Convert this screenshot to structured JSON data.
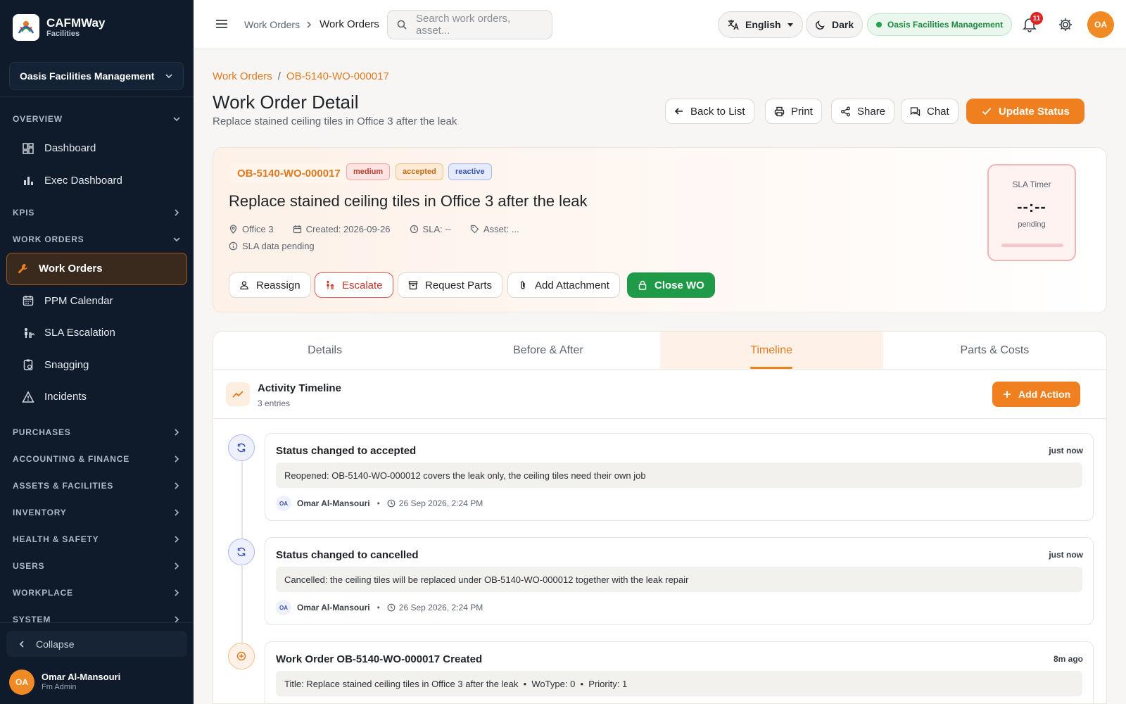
{
  "app": {
    "name": "CAFMWay",
    "subtitle": "Facilities"
  },
  "sidebar": {
    "org": "Oasis Facilities Management",
    "sections": [
      {
        "label": "OVERVIEW"
      },
      {
        "label": "KPIS"
      },
      {
        "label": "WORK ORDERS"
      },
      {
        "label": "PURCHASES"
      },
      {
        "label": "ACCOUNTING & FINANCE"
      },
      {
        "label": "ASSETS & FACILITIES"
      },
      {
        "label": "INVENTORY"
      },
      {
        "label": "HEALTH & SAFETY"
      },
      {
        "label": "USERS"
      },
      {
        "label": "WORKPLACE"
      },
      {
        "label": "SYSTEM"
      }
    ],
    "items": [
      {
        "label": "Dashboard",
        "icon": "dashboard-icon"
      },
      {
        "label": "Exec Dashboard",
        "icon": "bar-chart-icon"
      },
      {
        "label": "Work Orders",
        "icon": "wrench-icon",
        "active": true
      },
      {
        "label": "PPM Calendar",
        "icon": "calendar-icon"
      },
      {
        "label": "SLA Escalation",
        "icon": "escalation-icon"
      },
      {
        "label": "Snagging",
        "icon": "clipboard-icon"
      },
      {
        "label": "Incidents",
        "icon": "warning-icon"
      }
    ],
    "collapse_label": "Collapse",
    "user": {
      "initials": "OA",
      "name": "Omar Al-Mansouri",
      "role": "Fm Admin"
    }
  },
  "topbar": {
    "breadcrumb_parent": "Work Orders",
    "breadcrumb_current": "Work Orders",
    "search_placeholder": "Search work orders, asset...",
    "language": "English",
    "theme": "Dark",
    "org": "Oasis Facilities Management",
    "notifications": "11",
    "user_initials": "OA"
  },
  "page": {
    "breadcrumb": [
      "Work Orders",
      "OB-5140-WO-000017"
    ],
    "title": "Work Order Detail",
    "subtitle": "Replace stained ceiling tiles in Office 3 after the leak",
    "actions": {
      "back": "Back to List",
      "print": "Print",
      "share": "Share",
      "chat": "Chat",
      "update": "Update Status"
    }
  },
  "wo": {
    "id": "OB-5140-WO-000017",
    "tags": {
      "priority": "medium",
      "status": "accepted",
      "type": "reactive"
    },
    "title": "Replace stained ceiling tiles in Office 3 after the leak",
    "location": "Office 3",
    "created": "Created: 2026-09-26",
    "sla": "SLA: --",
    "asset": "Asset: ...",
    "sla_note": "SLA data pending",
    "buttons": {
      "reassign": "Reassign",
      "escalate": "Escalate",
      "parts": "Request Parts",
      "attach": "Add Attachment",
      "close": "Close WO"
    },
    "sla_timer": {
      "label": "SLA Timer",
      "value": "--:--",
      "state": "pending"
    }
  },
  "tabs": [
    "Details",
    "Before & After",
    "Timeline",
    "Parts & Costs"
  ],
  "active_tab": "Timeline",
  "timeline": {
    "title": "Activity Timeline",
    "count": "3 entries",
    "add_label": "Add Action",
    "entries": [
      {
        "title": "Status changed to accepted",
        "time": "just now",
        "note": "Reopened: OB-5140-WO-000012 covers the leak only, the ceiling tiles need their own job",
        "initials": "OA",
        "by": "Omar Al-Mansouri",
        "bullet": "•",
        "date": "26 Sep 2026, 2:24 PM"
      },
      {
        "title": "Status changed to cancelled",
        "time": "just now",
        "note": "Cancelled: the ceiling tiles will be replaced under OB-5140-WO-000012 together with the leak repair",
        "initials": "OA",
        "by": "Omar Al-Mansouri",
        "bullet": "•",
        "date": "26 Sep 2026, 2:24 PM"
      },
      {
        "title": "Work Order OB-5140-WO-000017 Created",
        "time": "8m ago",
        "note": "Title: Replace stained ceiling tiles in Office 3 after the leak  •  WoType: 0  •  Priority: 1"
      }
    ]
  },
  "colors": {
    "accent": "#f0801f",
    "sidebar": "#0f1b2b",
    "success": "#1f9a48",
    "danger": "#c0392b"
  }
}
